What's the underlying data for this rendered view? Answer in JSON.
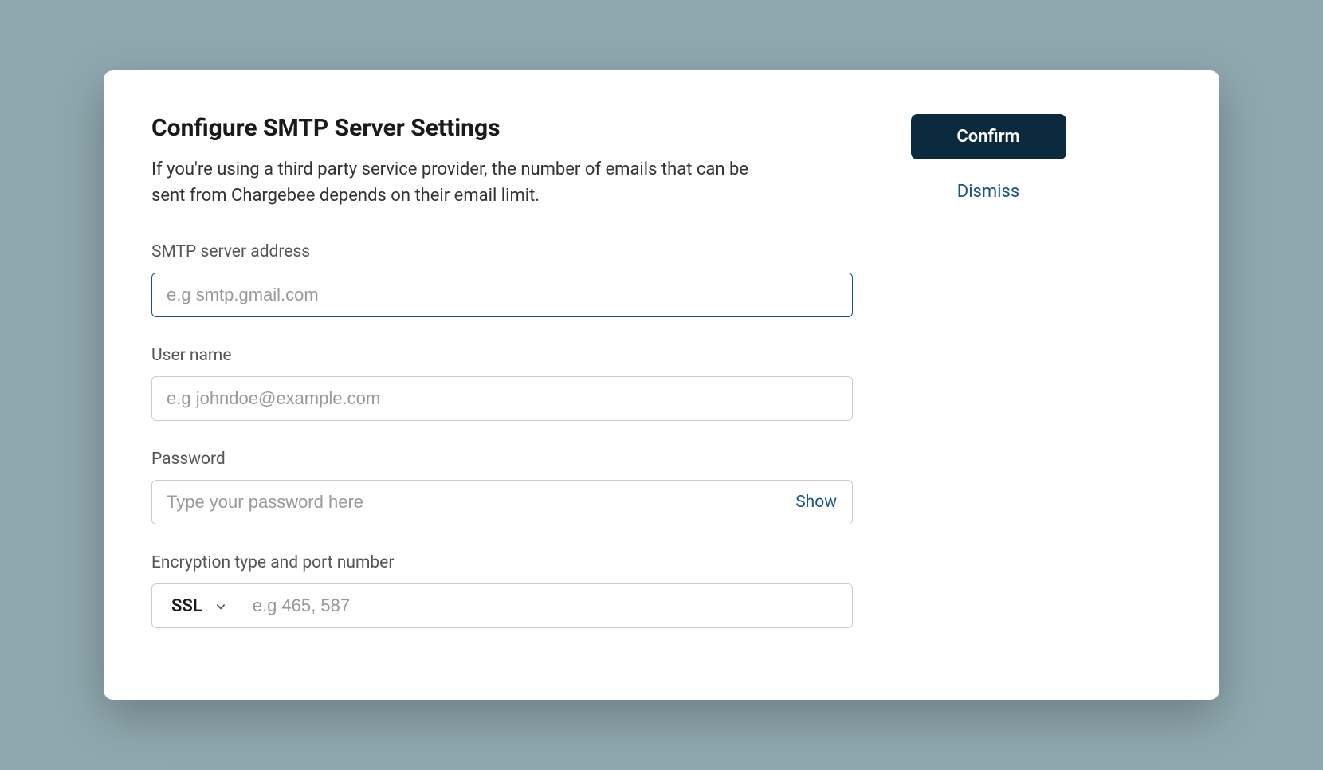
{
  "dialog": {
    "title": "Configure SMTP Server Settings",
    "description": "If you're using a third party service provider, the number of emails that can be sent from Chargebee depends on their email limit."
  },
  "form": {
    "smtp_address": {
      "label": "SMTP server address",
      "placeholder": "e.g smtp.gmail.com",
      "value": ""
    },
    "username": {
      "label": "User name",
      "placeholder": "e.g johndoe@example.com",
      "value": ""
    },
    "password": {
      "label": "Password",
      "placeholder": "Type your password here",
      "value": "",
      "show_label": "Show"
    },
    "encryption": {
      "label": "Encryption type and port number",
      "selected": "SSL",
      "port_placeholder": "e.g 465, 587",
      "port_value": ""
    }
  },
  "actions": {
    "confirm": "Confirm",
    "dismiss": "Dismiss"
  }
}
